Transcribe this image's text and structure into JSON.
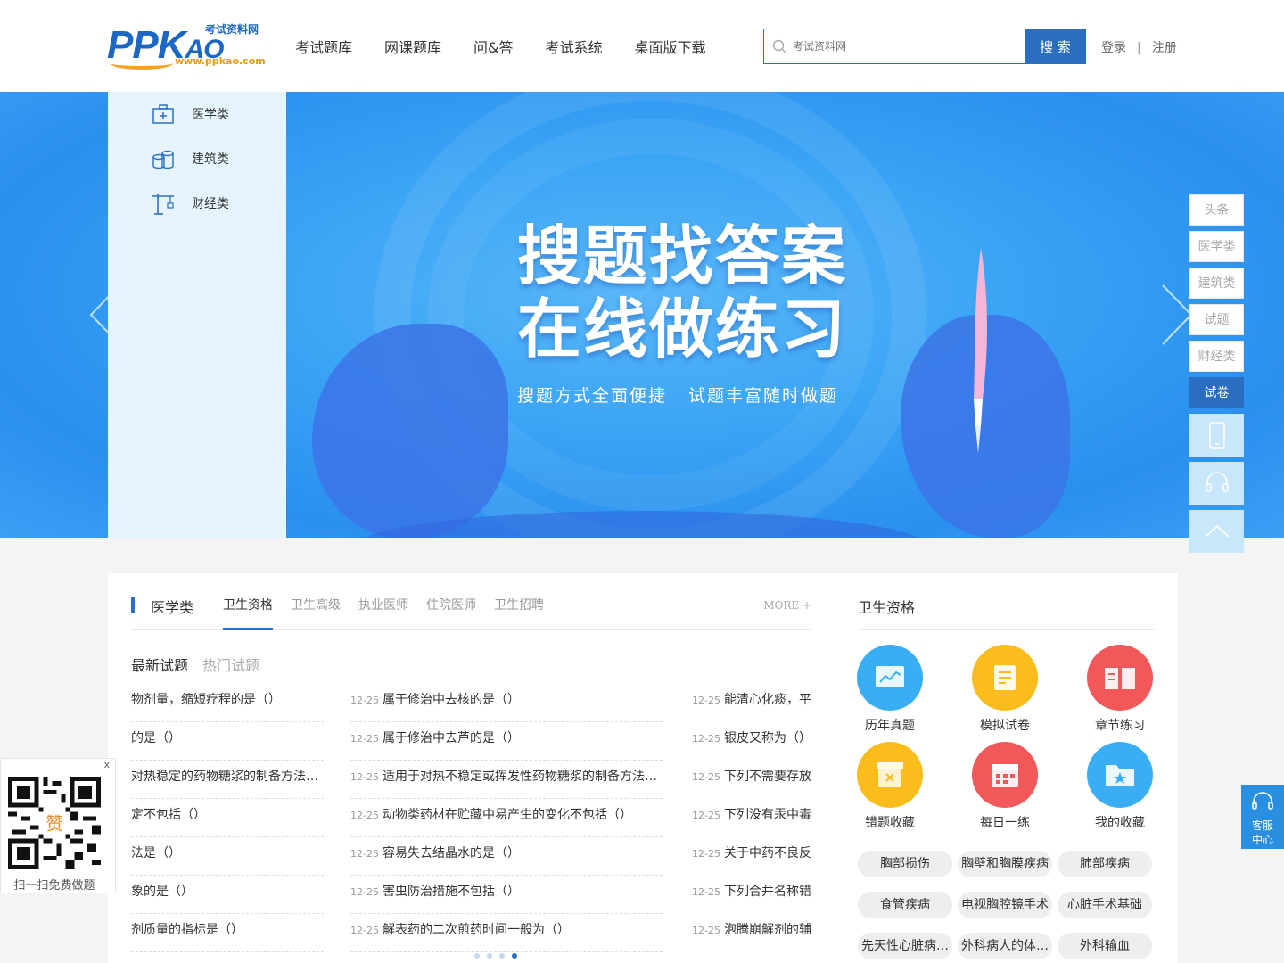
{
  "header": {
    "logo_main": "PPK",
    "logo_ao": "AO",
    "logo_cn": "考试资料网",
    "logo_url": "www.ppkao.com",
    "nav": [
      "考试题库",
      "网课题库",
      "问&答",
      "考试系统",
      "桌面版下载"
    ],
    "search_placeholder": "考试资料网",
    "search_button": "搜 索",
    "login": "登录",
    "separator": "|",
    "register": "注册"
  },
  "categories": [
    {
      "label": "医学类",
      "icon": "medical-kit-icon"
    },
    {
      "label": "建筑类",
      "icon": "coins-stack-icon"
    },
    {
      "label": "财经类",
      "icon": "crane-icon"
    }
  ],
  "banner": {
    "title_line1": "搜题找答案",
    "title_line2": "在线做练习",
    "subtitle": "搜题方式全面便捷   试题丰富随时做题"
  },
  "side_nav": [
    "头条",
    "医学类",
    "建筑类",
    "试题",
    "财经类",
    "试卷"
  ],
  "side_nav_active": "试卷",
  "section": {
    "title": "医学类",
    "tabs": [
      "卫生资格",
      "卫生高级",
      "执业医师",
      "住院医师",
      "卫生招聘"
    ],
    "active_tab": "卫生资格",
    "more": "MORE +",
    "sub_tabs": [
      "最新试题",
      "热门试题"
    ]
  },
  "questions": {
    "col1": [
      {
        "date": "",
        "text": "物剂量，缩短疗程的是（）"
      },
      {
        "date": "",
        "text": "的是（）"
      },
      {
        "date": "",
        "text": "对热稳定的药物糖浆的制备方法是（）"
      },
      {
        "date": "",
        "text": "定不包括（）"
      },
      {
        "date": "",
        "text": "法是（）"
      },
      {
        "date": "",
        "text": "象的是（）"
      },
      {
        "date": "",
        "text": "剂质量的指标是（）"
      }
    ],
    "col2": [
      {
        "date": "12-25",
        "text": "属于修治中去核的是（）"
      },
      {
        "date": "12-25",
        "text": "属于修治中去芦的是（）"
      },
      {
        "date": "12-25",
        "text": "适用于对热不稳定或挥发性药物糖浆的制备方法是（）"
      },
      {
        "date": "12-25",
        "text": "动物类药材在贮藏中易产生的变化不包括（）"
      },
      {
        "date": "12-25",
        "text": "容易失去结晶水的是（）"
      },
      {
        "date": "12-25",
        "text": "害虫防治措施不包括（）"
      },
      {
        "date": "12-25",
        "text": "解表药的二次煎药时间一般为（）"
      }
    ],
    "col3": [
      {
        "date": "12-25",
        "text": "能清心化痰，平肝"
      },
      {
        "date": "12-25",
        "text": "银皮又称为（）"
      },
      {
        "date": "12-25",
        "text": "下列不需要存放在"
      },
      {
        "date": "12-25",
        "text": "下列没有汞中毒现"
      },
      {
        "date": "12-25",
        "text": "关于中药不良反应"
      },
      {
        "date": "12-25",
        "text": "下列合并名称错误"
      },
      {
        "date": "12-25",
        "text": "泡腾崩解剂的辅料"
      }
    ]
  },
  "right_panel": {
    "title": "卫生资格",
    "features": [
      {
        "label": "历年真题",
        "color": "#3aaef5",
        "icon": "chart-board-icon"
      },
      {
        "label": "模拟试卷",
        "color": "#fbbd1b",
        "icon": "document-icon"
      },
      {
        "label": "章节练习",
        "color": "#f2585a",
        "icon": "open-book-icon"
      },
      {
        "label": "错题收藏",
        "color": "#fbbd1b",
        "icon": "error-box-icon"
      },
      {
        "label": "每日一练",
        "color": "#f2585a",
        "icon": "calendar-icon"
      },
      {
        "label": "我的收藏",
        "color": "#3aaef5",
        "icon": "star-folder-icon"
      }
    ],
    "tags": [
      "胸部损伤",
      "胸壁和胸膜疾病",
      "肺部疾病",
      "食管疾病",
      "电视胸腔镜手术",
      "心脏手术基础",
      "先天性心脏病的外科治疗",
      "外科病人的体液失调",
      "外科输血"
    ]
  },
  "qr_float": {
    "close": "x",
    "badge": "赞",
    "caption": "扫一扫免费做题"
  },
  "service": {
    "line1": "客服",
    "line2": "中心"
  },
  "colors": {
    "primary": "#2a6ec1",
    "banner": "#3aa4f5",
    "menu_bg": "#e6f4fd"
  }
}
